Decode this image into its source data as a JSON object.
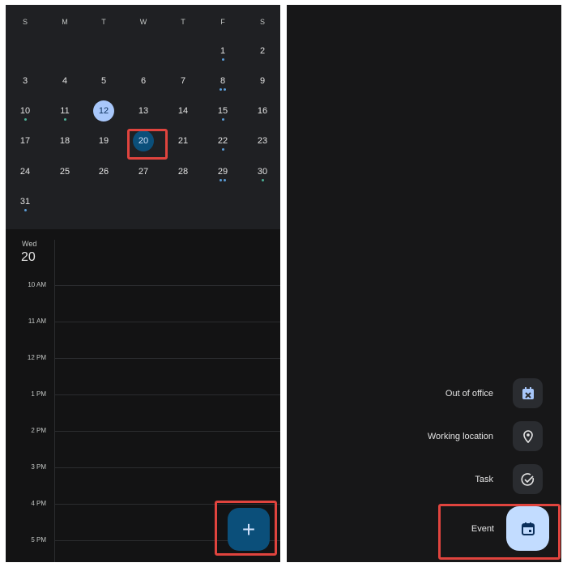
{
  "calendar": {
    "weekdays": [
      "S",
      "M",
      "T",
      "W",
      "T",
      "F",
      "S"
    ],
    "weeks": [
      [
        null,
        null,
        null,
        null,
        null,
        {
          "d": "1",
          "dots": [
            "blue"
          ]
        },
        {
          "d": "2"
        }
      ],
      [
        {
          "d": "3"
        },
        {
          "d": "4"
        },
        {
          "d": "5"
        },
        {
          "d": "6"
        },
        {
          "d": "7"
        },
        {
          "d": "8",
          "dots": [
            "blue",
            "blue"
          ]
        },
        {
          "d": "9"
        }
      ],
      [
        {
          "d": "10",
          "dots": [
            "green"
          ]
        },
        {
          "d": "11",
          "dots": [
            "green"
          ]
        },
        {
          "d": "12",
          "today": true
        },
        {
          "d": "13"
        },
        {
          "d": "14"
        },
        {
          "d": "15",
          "dots": [
            "blue"
          ]
        },
        {
          "d": "16"
        }
      ],
      [
        {
          "d": "17"
        },
        {
          "d": "18"
        },
        {
          "d": "19"
        },
        {
          "d": "20",
          "selected": true
        },
        {
          "d": "21"
        },
        {
          "d": "22",
          "dots": [
            "blue"
          ]
        },
        {
          "d": "23"
        }
      ],
      [
        {
          "d": "24"
        },
        {
          "d": "25"
        },
        {
          "d": "26"
        },
        {
          "d": "27"
        },
        {
          "d": "28"
        },
        {
          "d": "29",
          "dots": [
            "blue",
            "blue"
          ]
        },
        {
          "d": "30",
          "dots": [
            "green"
          ]
        }
      ],
      [
        {
          "d": "31",
          "dots": [
            "blue"
          ]
        },
        null,
        null,
        null,
        null,
        null,
        null
      ]
    ]
  },
  "day_view": {
    "weekday": "Wed",
    "date": "20",
    "times": [
      "10 AM",
      "11 AM",
      "12 PM",
      "1 PM",
      "2 PM",
      "3 PM",
      "4 PM",
      "5 PM"
    ]
  },
  "fab": {
    "icon": "plus-icon",
    "label": "+"
  },
  "create_menu": {
    "items": [
      {
        "label": "Out of office",
        "icon": "calendar-x-icon"
      },
      {
        "label": "Working location",
        "icon": "location-pin-icon"
      },
      {
        "label": "Task",
        "icon": "check-circle-icon"
      },
      {
        "label": "Event",
        "icon": "calendar-icon"
      }
    ]
  },
  "colors": {
    "selected": "#0b4f7a",
    "today": "#a8c7fa",
    "highlight": "#e0443e",
    "event_fab": "#c2dcff"
  }
}
